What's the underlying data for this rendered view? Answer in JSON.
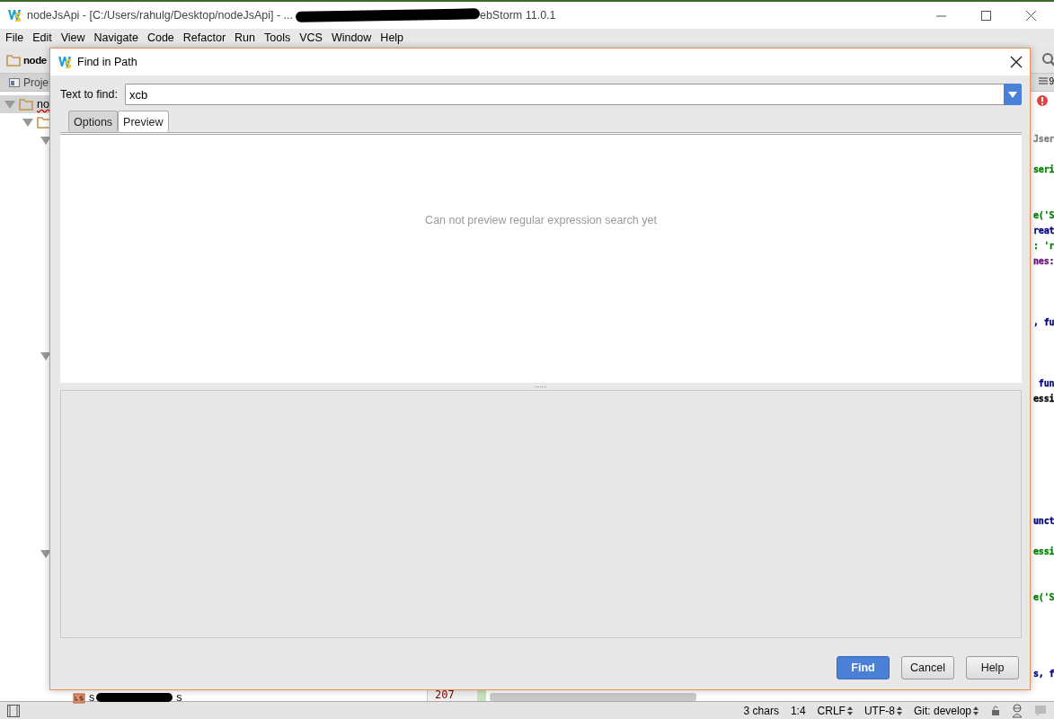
{
  "window": {
    "title": "nodeJsApi - [C:/Users/rahulg/Desktop/nodeJsApi] - ...",
    "title_tail": "ebStorm 11.0.1"
  },
  "menu": [
    "File",
    "Edit",
    "View",
    "Navigate",
    "Code",
    "Refactor",
    "Run",
    "Tools",
    "VCS",
    "Window",
    "Help"
  ],
  "toolbar": {
    "project": "node"
  },
  "tool_tabs": [
    {
      "label": "Proje"
    }
  ],
  "editor_tab_count": "9",
  "project_tree": [
    {
      "kind": "folder",
      "label": "no",
      "selected": true,
      "expanded": true,
      "children": [
        {
          "kind": "folder",
          "selected": false,
          "expanded": true,
          "children": [
            {
              "selected": false,
              "expanded": true
            },
            {
              "selected": false,
              "expanded": true
            },
            {
              "selected": false,
              "expanded": true,
              "children": [
                {
                  "kind": "file",
                  "selected": false,
                  "label": "s",
                  "label_tail": "s"
                }
              ]
            }
          ]
        }
      ]
    }
  ],
  "gutter": {
    "line_number": "207"
  },
  "editor_lines": [
    {
      "text": "Jser",
      "color": "#808080"
    },
    {
      "text": "seri",
      "color": "#008000"
    },
    {
      "text": "e('S",
      "color": "#008000"
    },
    {
      "text": "reat",
      "color": "#000080"
    },
    {
      "text": ": 'r",
      "color": "#008000"
    },
    {
      "text": "nes:",
      "color": "#660e7a"
    },
    {
      "text": ", fu",
      "color": "#000080"
    },
    {
      "text": " fun",
      "color": "#000080"
    },
    {
      "text": "essi",
      "color": "#000000"
    },
    {
      "text": "unct",
      "color": "#000080"
    },
    {
      "text": "essi",
      "color": "#008000"
    },
    {
      "text": "e('S",
      "color": "#008000"
    },
    {
      "text": "s, f",
      "color": "#000080"
    }
  ],
  "dialog": {
    "title": "Find in Path",
    "field_label": "Text to find:",
    "value": "xcb",
    "tabs": [
      {
        "label": "Options",
        "selected": false
      },
      {
        "label": "Preview",
        "selected": true
      }
    ],
    "preview_message": "Can not preview regular expression search yet",
    "buttons": [
      {
        "label": "Find",
        "kind": "primary"
      },
      {
        "label": "Cancel",
        "kind": "normal"
      },
      {
        "label": "Help",
        "kind": "normal"
      }
    ]
  },
  "status_bar": [
    "3 chars",
    "1:4",
    "CRLF",
    "UTF-8",
    "Git: develop"
  ]
}
